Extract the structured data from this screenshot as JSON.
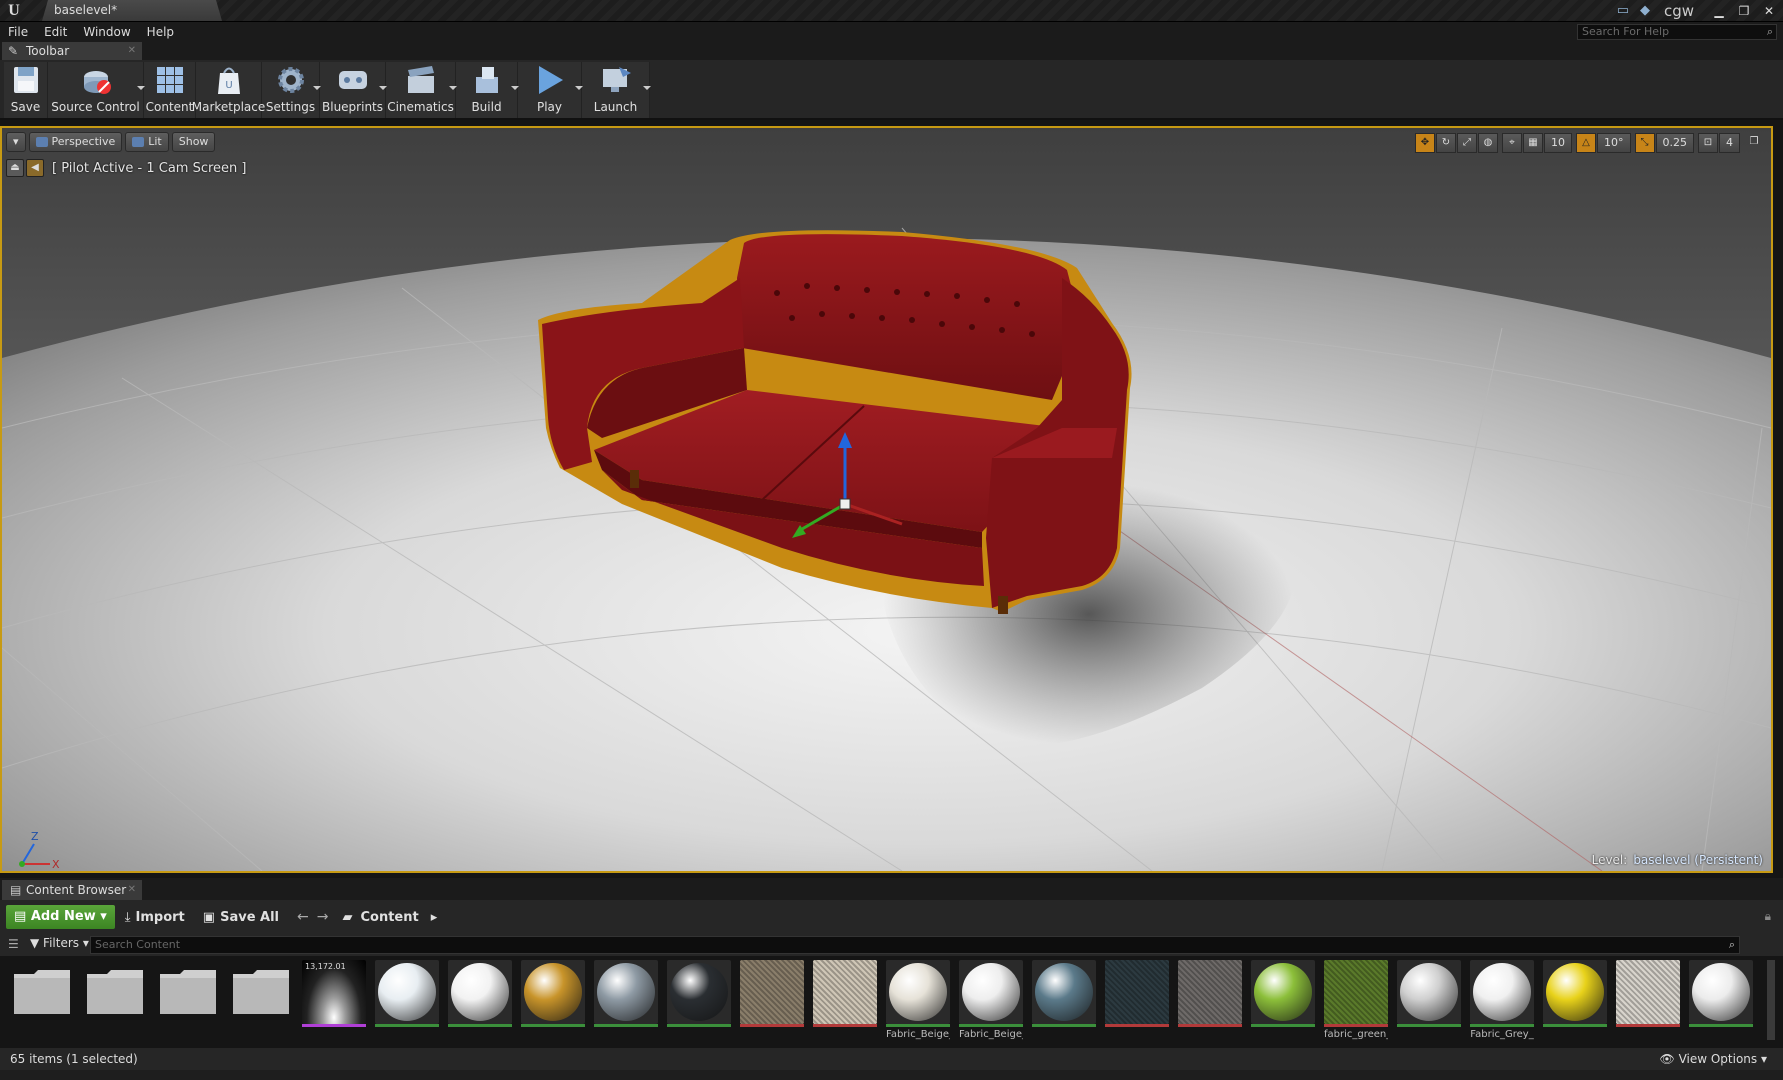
{
  "window": {
    "tab_title": "baselevel*",
    "user": "cgw"
  },
  "menu": [
    "File",
    "Edit",
    "Window",
    "Help"
  ],
  "help_search": {
    "placeholder": "Search For Help"
  },
  "toolbar_tab": {
    "label": "Toolbar"
  },
  "toolbar": {
    "save": "Save",
    "source_control": "Source Control",
    "content": "Content",
    "marketplace": "Marketplace",
    "settings": "Settings",
    "blueprints": "Blueprints",
    "cinematics": "Cinematics",
    "build": "Build",
    "play": "Play",
    "launch": "Launch"
  },
  "viewport": {
    "perspective": "Perspective",
    "lit": "Lit",
    "show": "Show",
    "pilot": "[ Pilot Active - 1 Cam Screen ]",
    "grid_snap": "10",
    "rot_snap": "10°",
    "scale_snap": "0.25",
    "cam_speed": "4",
    "level_prefix": "Level:",
    "level_name": "baselevel (Persistent)",
    "axis_z": "Z",
    "axis_x": "X"
  },
  "content_browser": {
    "tab": "Content Browser",
    "add_new": "Add New",
    "import": "Import",
    "save_all": "Save All",
    "path": "Content",
    "filters": "Filters",
    "search_placeholder": "Search Content",
    "items_status": "65 items (1 selected)",
    "view_options": "View Options",
    "assets": [
      {
        "name": "",
        "kind": "folder"
      },
      {
        "name": "",
        "kind": "folder"
      },
      {
        "name": "",
        "kind": "folder"
      },
      {
        "name": "",
        "kind": "folder"
      },
      {
        "name": "",
        "kind": "hdri",
        "badge": "13,172.01",
        "bar": "#b03fd6"
      },
      {
        "name": "",
        "kind": "sphere",
        "color": "#e8eef2",
        "bar": "#3b8f3b"
      },
      {
        "name": "",
        "kind": "sphere",
        "color": "#f2f2f2",
        "bar": "#3b8f3b"
      },
      {
        "name": "",
        "kind": "sphere",
        "color": "#c8942a",
        "bar": "#3b8f3b"
      },
      {
        "name": "",
        "kind": "sphere",
        "color": "#8e9aa4",
        "bar": "#3b8f3b"
      },
      {
        "name": "",
        "kind": "sphere",
        "color": "#2a2e32",
        "bar": "#3b8f3b"
      },
      {
        "name": "",
        "kind": "texture",
        "color": "#8a7e6a",
        "bar": "#b23a3a"
      },
      {
        "name": "",
        "kind": "texture",
        "color": "#cfc6b6",
        "bar": "#b23a3a"
      },
      {
        "name": "Fabric_Beige_",
        "kind": "sphere",
        "color": "#e6e2d8",
        "bar": "#3b8f3b"
      },
      {
        "name": "Fabric_Beige_",
        "kind": "sphere",
        "color": "#eeeeee",
        "bar": "#3b8f3b"
      },
      {
        "name": "",
        "kind": "sphere",
        "color": "#5b7a8a",
        "bar": "#3b8f3b"
      },
      {
        "name": "",
        "kind": "texture",
        "color": "#2c3a40",
        "bar": "#b23a3a"
      },
      {
        "name": "",
        "kind": "texture",
        "color": "#6e6a68",
        "bar": "#b23a3a"
      },
      {
        "name": "",
        "kind": "sphere",
        "color": "#8cbf3a",
        "bar": "#3b8f3b"
      },
      {
        "name": "fabric_green_",
        "kind": "texture",
        "color": "#5a7a2a",
        "bar": "#b23a3a"
      },
      {
        "name": "",
        "kind": "sphere",
        "color": "#cfcfcf",
        "bar": "#3b8f3b"
      },
      {
        "name": "Fabric_Grey_",
        "kind": "sphere",
        "color": "#f0f0f0",
        "bar": "#3b8f3b"
      },
      {
        "name": "",
        "kind": "sphere",
        "color": "#e8d21a",
        "bar": "#3b8f3b"
      },
      {
        "name": "",
        "kind": "texture",
        "color": "#d8d4cc",
        "bar": "#b23a3a"
      },
      {
        "name": "",
        "kind": "sphere",
        "color": "#ececec",
        "bar": "#3b8f3b"
      }
    ]
  },
  "colors": {
    "accent_orange": "#c79a13",
    "sofa_red": "#8a1418",
    "add_new_green": "#4a9a2e"
  }
}
